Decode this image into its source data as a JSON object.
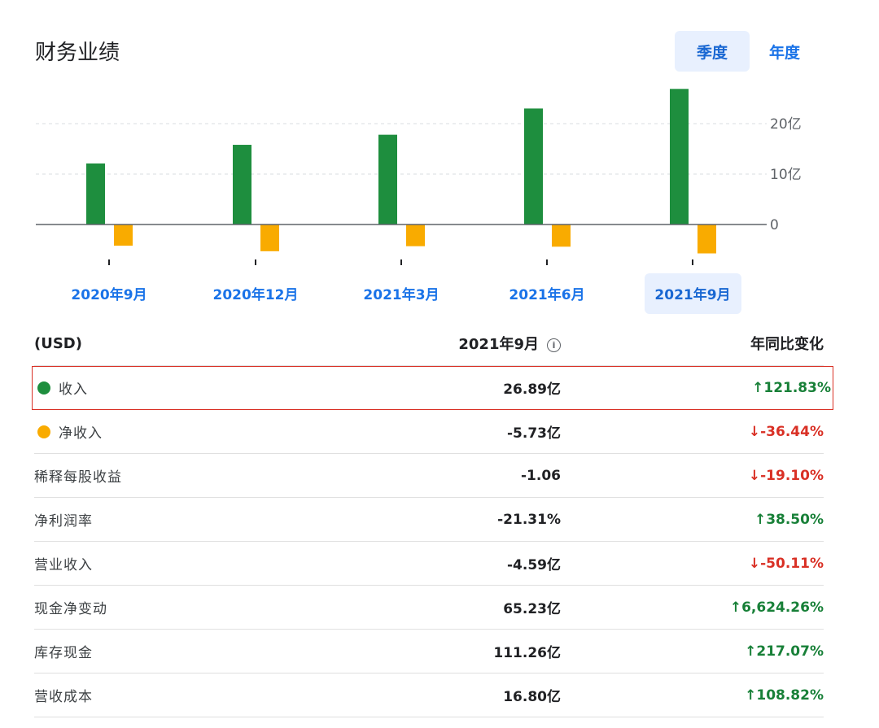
{
  "page": {
    "title": "财务业绩",
    "toggle": [
      {
        "label": "季度",
        "active": true
      },
      {
        "label": "年度",
        "active": false
      }
    ]
  },
  "chart_data": {
    "type": "bar",
    "categories": [
      "2020年9月",
      "2020年12月",
      "2021年3月",
      "2021年6月",
      "2021年9月"
    ],
    "selected_category": "2021年9月",
    "series": [
      {
        "name": "收入",
        "color": "#1e8e3e",
        "values": [
          12.1,
          15.8,
          17.8,
          23.0,
          26.89
        ]
      },
      {
        "name": "净收入",
        "color": "#f9ab00",
        "values": [
          -4.2,
          -5.3,
          -4.3,
          -4.4,
          -5.73
        ]
      }
    ],
    "yticks": [
      0,
      10,
      20
    ],
    "ytick_labels": [
      "0",
      "10亿",
      "20亿"
    ],
    "ylim": [
      -6,
      27
    ],
    "grid": true,
    "axis_position": "right"
  },
  "table": {
    "header": {
      "currency": "(USD)",
      "period": "2021年9月",
      "change": "年同比变化"
    },
    "rows": [
      {
        "name": "收入",
        "value": "26.89亿",
        "change": "121.83%",
        "dir": "up",
        "dot": "#1e8e3e",
        "highlight": true
      },
      {
        "name": "净收入",
        "value": "-5.73亿",
        "change": "-36.44%",
        "dir": "down",
        "dot": "#f9ab00"
      },
      {
        "name": "稀释每股收益",
        "value": "-1.06",
        "change": "-19.10%",
        "dir": "down"
      },
      {
        "name": "净利润率",
        "value": "-21.31%",
        "change": "38.50%",
        "dir": "up"
      },
      {
        "name": "营业收入",
        "value": "-4.59亿",
        "change": "-50.11%",
        "dir": "down"
      },
      {
        "name": "现金净变动",
        "value": "65.23亿",
        "change": "6,624.26%",
        "dir": "up"
      },
      {
        "name": "库存现金",
        "value": "111.26亿",
        "change": "217.07%",
        "dir": "up"
      },
      {
        "name": "营收成本",
        "value": "16.80亿",
        "change": "108.82%",
        "dir": "up"
      }
    ]
  }
}
